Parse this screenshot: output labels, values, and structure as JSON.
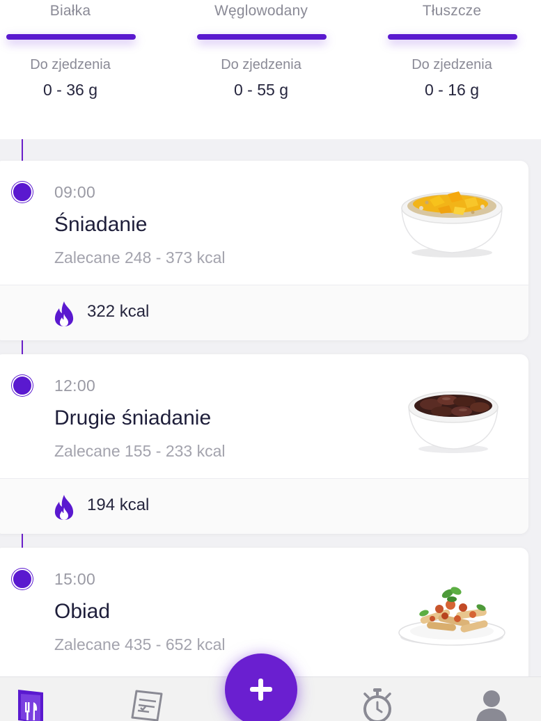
{
  "macros": [
    {
      "name": "Białka",
      "sub_label": "Do zjedzenia",
      "value": "0 - 36 g"
    },
    {
      "name": "Węglowodany",
      "sub_label": "Do zjedzenia",
      "value": "0 - 55 g"
    },
    {
      "name": "Tłuszcze",
      "sub_label": "Do zjedzenia",
      "value": "0 - 16 g"
    }
  ],
  "meals": [
    {
      "time": "09:00",
      "name": "Śniadanie",
      "recommended": "Zalecane 248 - 373 kcal",
      "kcal": "322 kcal",
      "image": "fruit-bowl-image"
    },
    {
      "time": "12:00",
      "name": "Drugie śniadanie",
      "recommended": "Zalecane 155 - 233 kcal",
      "kcal": "194 kcal",
      "image": "dates-bowl-image"
    },
    {
      "time": "15:00",
      "name": "Obiad",
      "recommended": "Zalecane 435 - 652 kcal",
      "kcal": "",
      "image": "pasta-plate-image"
    }
  ],
  "nav": {
    "items": [
      "diary-icon",
      "recipes-icon",
      "add-icon",
      "fasting-timer-icon",
      "profile-icon"
    ]
  },
  "colors": {
    "accent": "#5a19cf",
    "fab": "#6a1fd0",
    "text_dark": "#1e1e3a",
    "text_muted": "#9a9aa4",
    "background": "#f1f1f4"
  }
}
